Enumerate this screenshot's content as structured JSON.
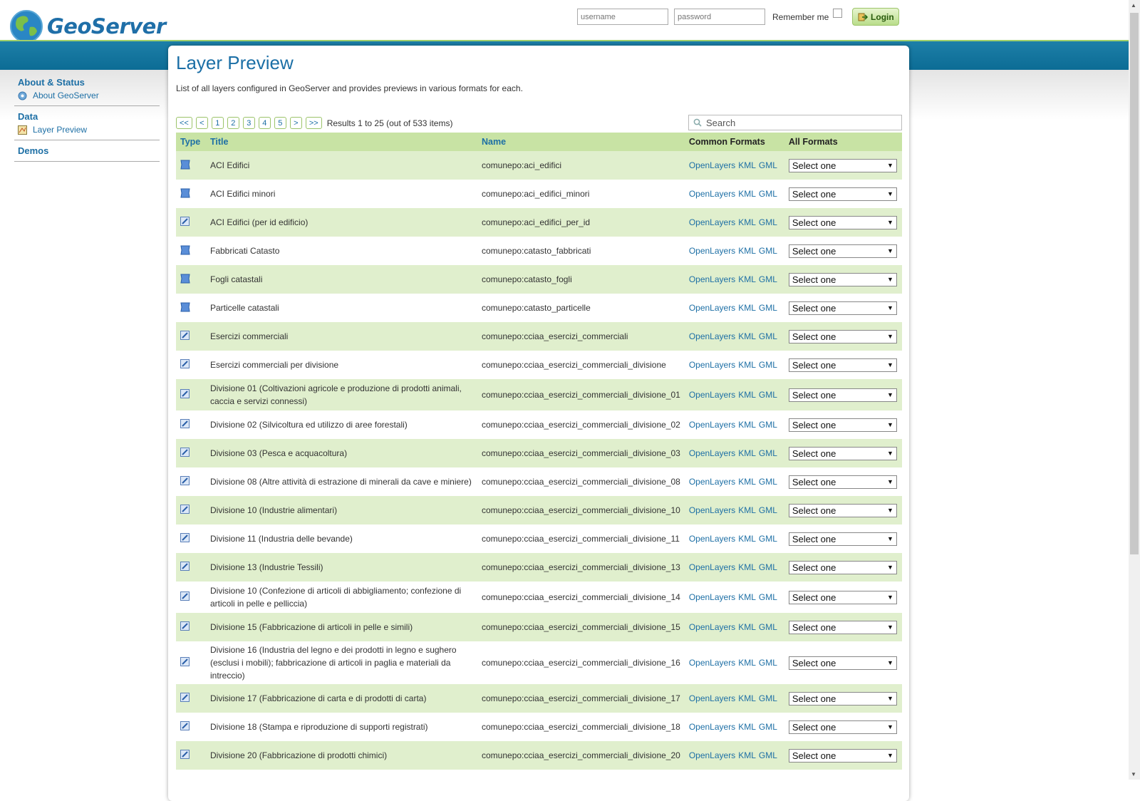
{
  "app": {
    "name": "GeoServer"
  },
  "login": {
    "username_placeholder": "username",
    "password_placeholder": "password",
    "remember_label": "Remember me",
    "login_label": "Login"
  },
  "sidebar": {
    "sections": [
      {
        "heading": "About & Status",
        "item": "About GeoServer"
      },
      {
        "heading": "Data",
        "item": "Layer Preview"
      },
      {
        "heading": "Demos"
      }
    ]
  },
  "page": {
    "title": "Layer Preview",
    "description": "List of all layers configured in GeoServer and provides previews in various formats for each."
  },
  "pager": {
    "buttons": [
      "<<",
      "<",
      "1",
      "2",
      "3",
      "4",
      "5",
      ">",
      ">>"
    ],
    "results": "Results 1 to 25 (out of 533 items)"
  },
  "search": {
    "placeholder": "Search"
  },
  "table": {
    "headers": {
      "type": "Type",
      "title": "Title",
      "name": "Name",
      "common": "Common Formats",
      "all": "All Formats"
    },
    "formats": [
      "OpenLayers",
      "KML",
      "GML"
    ],
    "select_default": "Select one",
    "rows": [
      {
        "type": "polygon",
        "title": "ACI Edifici",
        "name": "comunepo:aci_edifici"
      },
      {
        "type": "polygon",
        "title": "ACI Edifici minori",
        "name": "comunepo:aci_edifici_minori"
      },
      {
        "type": "point",
        "title": "ACI Edifici (per id edificio)",
        "name": "comunepo:aci_edifici_per_id"
      },
      {
        "type": "polygon",
        "title": "Fabbricati Catasto",
        "name": "comunepo:catasto_fabbricati"
      },
      {
        "type": "polygon",
        "title": "Fogli catastali",
        "name": "comunepo:catasto_fogli"
      },
      {
        "type": "polygon",
        "title": "Particelle catastali",
        "name": "comunepo:catasto_particelle"
      },
      {
        "type": "point",
        "title": "Esercizi commerciali",
        "name": "comunepo:cciaa_esercizi_commerciali"
      },
      {
        "type": "point",
        "title": "Esercizi commerciali per divisione",
        "name": "comunepo:cciaa_esercizi_commerciali_divisione"
      },
      {
        "type": "point",
        "title": "Divisione 01 (Coltivazioni agricole e produzione di prodotti animali, caccia e servizi connessi)",
        "name": "comunepo:cciaa_esercizi_commerciali_divisione_01",
        "lines": 2
      },
      {
        "type": "point",
        "title": "Divisione 02 (Silvicoltura ed utilizzo di aree forestali)",
        "name": "comunepo:cciaa_esercizi_commerciali_divisione_02"
      },
      {
        "type": "point",
        "title": "Divisione 03 (Pesca e acquacoltura)",
        "name": "comunepo:cciaa_esercizi_commerciali_divisione_03"
      },
      {
        "type": "point",
        "title": "Divisione 08 (Altre attività di estrazione di minerali da cave e miniere)",
        "name": "comunepo:cciaa_esercizi_commerciali_divisione_08"
      },
      {
        "type": "point",
        "title": "Divisione 10 (Industrie alimentari)",
        "name": "comunepo:cciaa_esercizi_commerciali_divisione_10"
      },
      {
        "type": "point",
        "title": "Divisione 11 (Industria delle bevande)",
        "name": "comunepo:cciaa_esercizi_commerciali_divisione_11"
      },
      {
        "type": "point",
        "title": "Divisione 13 (Industrie Tessili)",
        "name": "comunepo:cciaa_esercizi_commerciali_divisione_13"
      },
      {
        "type": "point",
        "title": "Divisione 10 (Confezione di articoli di abbigliamento; confezione di articoli in pelle e pelliccia)",
        "name": "comunepo:cciaa_esercizi_commerciali_divisione_14",
        "lines": 2
      },
      {
        "type": "point",
        "title": "Divisione 15 (Fabbricazione di articoli in pelle e simili)",
        "name": "comunepo:cciaa_esercizi_commerciali_divisione_15"
      },
      {
        "type": "point",
        "title": "Divisione 16 (Industria del legno e dei prodotti in legno e sughero (esclusi i mobili); fabbricazione di articoli in paglia e materiali da intreccio)",
        "name": "comunepo:cciaa_esercizi_commerciali_divisione_16",
        "lines": 3
      },
      {
        "type": "point",
        "title": "Divisione 17 (Fabbricazione di carta e di prodotti di carta)",
        "name": "comunepo:cciaa_esercizi_commerciali_divisione_17"
      },
      {
        "type": "point",
        "title": "Divisione 18 (Stampa e riproduzione di supporti registrati)",
        "name": "comunepo:cciaa_esercizi_commerciali_divisione_18"
      },
      {
        "type": "point",
        "title": "Divisione 20 (Fabbricazione di prodotti chimici)",
        "name": "comunepo:cciaa_esercizi_commerciali_divisione_20"
      }
    ]
  },
  "colors": {
    "brand": "#1b6fa6",
    "header_band": "#0b6b94",
    "row_alt": "#e0efcd",
    "table_header": "#c8e3a4"
  }
}
